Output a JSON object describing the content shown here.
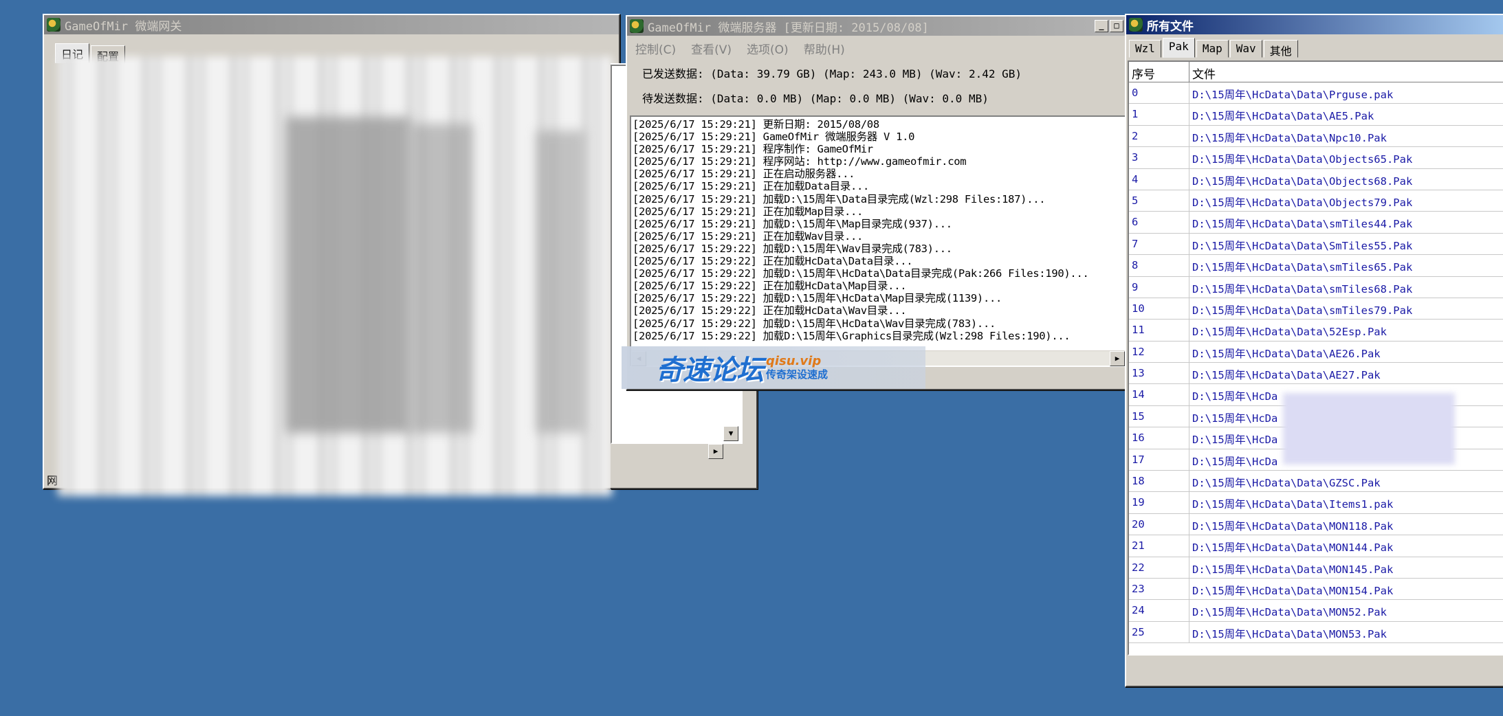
{
  "colors": {
    "desktop": "#3a6ea5",
    "titlebar_active": "#0a246a",
    "titlebar_inactive": "#808080",
    "link_text": "#1a1aa6",
    "watermark_blue": "#1f6fd0",
    "watermark_orange": "#e07a1a"
  },
  "gateway": {
    "title": "GameOfMir 微端网关",
    "icon": "gameofmir-icon",
    "tabs": [
      "日记",
      "配置"
    ],
    "status_prefix": "网"
  },
  "server": {
    "title": "GameOfMir 微端服务器 [更新日期: 2015/08/08]",
    "icon": "gameofmir-icon",
    "menu": [
      "控制(C)",
      "查看(V)",
      "选项(O)",
      "帮助(H)"
    ],
    "sent": "已发送数据: (Data: 39.79 GB) (Map: 243.0 MB) (Wav: 2.42 GB)",
    "pending": "待发送数据: (Data: 0.0 MB) (Map: 0.0 MB) (Wav: 0.0 MB)",
    "log": [
      "[2025/6/17 15:29:21] 更新日期: 2015/08/08",
      "[2025/6/17 15:29:21] GameOfMir 微端服务器 V 1.0",
      "[2025/6/17 15:29:21] 程序制作: GameOfMir",
      "[2025/6/17 15:29:21] 程序网站: http://www.gameofmir.com",
      "[2025/6/17 15:29:21] 正在启动服务器...",
      "[2025/6/17 15:29:21] 正在加载Data目录...",
      "[2025/6/17 15:29:21] 加载D:\\15周年\\Data目录完成(Wzl:298 Files:187)...",
      "[2025/6/17 15:29:21] 正在加载Map目录...",
      "[2025/6/17 15:29:21] 加载D:\\15周年\\Map目录完成(937)...",
      "[2025/6/17 15:29:21] 正在加载Wav目录...",
      "[2025/6/17 15:29:22] 加载D:\\15周年\\Wav目录完成(783)...",
      "[2025/6/17 15:29:22] 正在加载HcData\\Data目录...",
      "[2025/6/17 15:29:22] 加载D:\\15周年\\HcData\\Data目录完成(Pak:266 Files:190)...",
      "[2025/6/17 15:29:22] 正在加载HcData\\Map目录...",
      "[2025/6/17 15:29:22] 加载D:\\15周年\\HcData\\Map目录完成(1139)...",
      "[2025/6/17 15:29:22] 正在加载HcData\\Wav目录...",
      "[2025/6/17 15:29:22] 加载D:\\15周年\\HcData\\Wav目录完成(783)...",
      "[2025/6/17 15:29:22] 加载D:\\15周年\\Graphics目录完成(Wzl:298 Files:190)..."
    ]
  },
  "watermark": {
    "main": "奇速论坛",
    "url": "qisu.vip",
    "sub": "传奇架设速成"
  },
  "files": {
    "title": "所有文件",
    "icon": "gameofmir-icon",
    "tabs": [
      "Wzl",
      "Pak",
      "Map",
      "Wav",
      "其他"
    ],
    "selected_tab": "Pak",
    "columns": [
      "序号",
      "文件"
    ],
    "rows": [
      [
        "0",
        "D:\\15周年\\HcData\\Data\\Prguse.pak"
      ],
      [
        "1",
        "D:\\15周年\\HcData\\Data\\AE5.Pak"
      ],
      [
        "2",
        "D:\\15周年\\HcData\\Data\\Npc10.Pak"
      ],
      [
        "3",
        "D:\\15周年\\HcData\\Data\\Objects65.Pak"
      ],
      [
        "4",
        "D:\\15周年\\HcData\\Data\\Objects68.Pak"
      ],
      [
        "5",
        "D:\\15周年\\HcData\\Data\\Objects79.Pak"
      ],
      [
        "6",
        "D:\\15周年\\HcData\\Data\\smTiles44.Pak"
      ],
      [
        "7",
        "D:\\15周年\\HcData\\Data\\SmTiles55.Pak"
      ],
      [
        "8",
        "D:\\15周年\\HcData\\Data\\smTiles65.Pak"
      ],
      [
        "9",
        "D:\\15周年\\HcData\\Data\\smTiles68.Pak"
      ],
      [
        "10",
        "D:\\15周年\\HcData\\Data\\smTiles79.Pak"
      ],
      [
        "11",
        "D:\\15周年\\HcData\\Data\\52Esp.Pak"
      ],
      [
        "12",
        "D:\\15周年\\HcData\\Data\\AE26.Pak"
      ],
      [
        "13",
        "D:\\15周年\\HcData\\Data\\AE27.Pak"
      ],
      [
        "14",
        "D:\\15周年\\HcDa"
      ],
      [
        "15",
        "D:\\15周年\\HcDa"
      ],
      [
        "16",
        "D:\\15周年\\HcDa"
      ],
      [
        "17",
        "D:\\15周年\\HcDa"
      ],
      [
        "18",
        "D:\\15周年\\HcData\\Data\\GZSC.Pak"
      ],
      [
        "19",
        "D:\\15周年\\HcData\\Data\\Items1.pak"
      ],
      [
        "20",
        "D:\\15周年\\HcData\\Data\\MON118.Pak"
      ],
      [
        "21",
        "D:\\15周年\\HcData\\Data\\MON144.Pak"
      ],
      [
        "22",
        "D:\\15周年\\HcData\\Data\\MON145.Pak"
      ],
      [
        "23",
        "D:\\15周年\\HcData\\Data\\MON154.Pak"
      ],
      [
        "24",
        "D:\\15周年\\HcData\\Data\\MON52.Pak"
      ],
      [
        "25",
        "D:\\15周年\\HcData\\Data\\MON53.Pak"
      ]
    ]
  }
}
